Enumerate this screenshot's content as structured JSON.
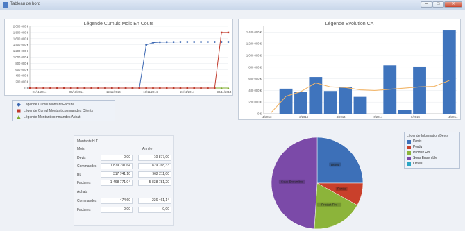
{
  "window": {
    "title": "Tableau de bord",
    "caption": "",
    "controls": {
      "minimize": "–",
      "maximize": "□",
      "close": "✕"
    }
  },
  "chart1": {
    "title": "Légende Cumuls Mois En Cours",
    "chart_data": {
      "type": "line",
      "title": "Légende Cumuls Mois En Cours",
      "y_ticks": [
        "2 000 000 €",
        "1 800 000 €",
        "1 600 000 €",
        "1 400 000 €",
        "1 200 000 €",
        "1 000 000 €",
        "800 000 €",
        "600 000 €",
        "400 000 €",
        "200 000 €",
        "0 €"
      ],
      "ylim": [
        0,
        2000000
      ],
      "x_ticks": [
        "01/11/2014",
        "06/11/2014",
        "12/11/2014",
        "18/11/2014",
        "24/11/2014",
        "30/11/2014"
      ],
      "xlim": [
        1,
        30
      ],
      "grid": true,
      "series": [
        {
          "name": "Légende Cumul Montant Facturé",
          "color": "#3b67b2",
          "x": [
            1,
            2,
            3,
            4,
            5,
            6,
            7,
            8,
            9,
            10,
            11,
            12,
            13,
            14,
            15,
            16,
            17,
            18,
            19,
            20,
            21,
            22,
            23,
            24,
            25,
            26,
            27,
            28,
            29,
            30
          ],
          "y": [
            0,
            0,
            0,
            0,
            0,
            0,
            0,
            0,
            0,
            0,
            0,
            0,
            0,
            0,
            0,
            0,
            0,
            1400000,
            1470000,
            1485000,
            1490000,
            1492000,
            1493000,
            1494000,
            1494000,
            1495000,
            1495000,
            1495000,
            1495000,
            1495000
          ]
        },
        {
          "name": "Légende Cumul Montant commandes Clients",
          "color": "#c0392b",
          "x": [
            1,
            2,
            3,
            4,
            5,
            6,
            7,
            8,
            9,
            10,
            11,
            12,
            13,
            14,
            15,
            16,
            17,
            18,
            19,
            20,
            21,
            22,
            23,
            24,
            25,
            26,
            27,
            28,
            29,
            30
          ],
          "y": [
            0,
            0,
            0,
            0,
            0,
            0,
            0,
            0,
            0,
            0,
            0,
            0,
            0,
            0,
            0,
            0,
            0,
            0,
            0,
            0,
            0,
            0,
            0,
            0,
            0,
            0,
            0,
            0,
            1800000,
            1800000
          ]
        },
        {
          "name": "Légende Montant commandes Achat",
          "color": "#7dab2e",
          "x": [
            1,
            2,
            3,
            4,
            5,
            6,
            7,
            8,
            9,
            10,
            11,
            12,
            13,
            14,
            15,
            16,
            17,
            18,
            19,
            20,
            21,
            22,
            23,
            24,
            25,
            26,
            27,
            28,
            29,
            30
          ],
          "y": [
            0,
            0,
            0,
            0,
            0,
            0,
            0,
            0,
            0,
            0,
            0,
            0,
            0,
            0,
            0,
            0,
            0,
            0,
            0,
            0,
            0,
            0,
            0,
            0,
            0,
            0,
            0,
            0,
            0,
            0
          ]
        }
      ]
    }
  },
  "legend1": {
    "items": [
      {
        "label": "Légende Cumul Montant Facturé",
        "color": "#3b67b2"
      },
      {
        "label": "Légende Cumul Montant commandes Clients",
        "color": "#c0392b"
      },
      {
        "label": "Légende Montant commandes Achat",
        "color": "#7dab2e"
      }
    ]
  },
  "chart2": {
    "title": "Légende Evolution CA",
    "chart_data": {
      "type": "bar",
      "title": "Légende Evolution CA",
      "y_ticks": [
        "1 400 000 €",
        "1 200 000 €",
        "1 000 000 €",
        "800 000 €",
        "600 000 €",
        "400 000 €",
        "200 000 €",
        "0 €"
      ],
      "ylim": [
        0,
        1500000
      ],
      "x_ticks": [
        "11/2013",
        "2/2014",
        "4/2014",
        "6/2014",
        "8/2014",
        "11/2014"
      ],
      "categories": [
        "11/2013",
        "12/2013",
        "1/2014",
        "2/2014",
        "3/2014",
        "4/2014",
        "5/2014",
        "6/2014",
        "7/2014",
        "8/2014",
        "9/2014",
        "10/2014",
        "11/2014"
      ],
      "grid": true,
      "series": [
        {
          "name": "",
          "type": "bar",
          "color": "#3f74bd",
          "values": [
            0,
            430000,
            380000,
            630000,
            390000,
            460000,
            290000,
            0,
            830000,
            60000,
            810000,
            0,
            1440000
          ]
        },
        {
          "name": "",
          "type": "line",
          "color": "#f2b66a",
          "values": [
            20000,
            300000,
            380000,
            530000,
            460000,
            450000,
            410000,
            400000,
            420000,
            440000,
            460000,
            470000,
            570000
          ]
        }
      ]
    }
  },
  "summary": {
    "title": "Montants H.T.",
    "col_mois": "Mois",
    "col_annee": "Année",
    "section_achat": "Achats",
    "ventes": [
      {
        "label": "Devis",
        "mois": "0,00",
        "annee": "10 877,00"
      },
      {
        "label": "Commandes",
        "mois": "1 879 791,64",
        "annee": "879 768,33"
      },
      {
        "label": "BL",
        "mois": "317 741,10",
        "annee": "962 211,00"
      },
      {
        "label": "Factures",
        "mois": "1 468 771,04",
        "annee": "5 838 781,20"
      }
    ],
    "achats": [
      {
        "label": "Commandes",
        "mois": "474,60",
        "annee": "236 461,14"
      },
      {
        "label": "Factures",
        "mois": "0,00",
        "annee": "0,00"
      }
    ]
  },
  "pie": {
    "legend_title": "Légende Information Devis",
    "chart_data": {
      "type": "pie",
      "title": "",
      "slices": [
        {
          "label": "Devis",
          "value": 25,
          "color": "#3d70b8",
          "show_label": true
        },
        {
          "label": "Perdu",
          "value": 8,
          "color": "#c9402b",
          "show_label": true
        },
        {
          "label": "Produit Fini",
          "value": 18,
          "color": "#8cb43a",
          "show_label": true
        },
        {
          "label": "Sous Ensemble",
          "value": 49,
          "color": "#7b4aa8",
          "show_label": true
        },
        {
          "label": "Offres",
          "value": 0,
          "color": "#2aa6c4",
          "show_label": false
        }
      ]
    }
  }
}
